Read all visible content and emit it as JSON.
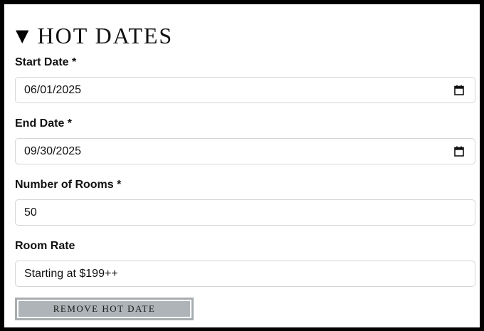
{
  "section": {
    "caret": "▼",
    "title": "HOT DATES"
  },
  "fields": {
    "start_date": {
      "label": "Start Date *",
      "value": "06/01/2025",
      "icon": "calendar-icon"
    },
    "end_date": {
      "label": "End Date *",
      "value": "09/30/2025",
      "icon": "calendar-icon"
    },
    "rooms": {
      "label": "Number of Rooms *",
      "value": "50"
    },
    "rate": {
      "label": "Room Rate",
      "value": "Starting at $199++"
    }
  },
  "actions": {
    "remove_label": "REMOVE HOT DATE"
  },
  "colors": {
    "frame": "#000000",
    "field_border": "#d6d6d6",
    "button_fill": "#aeb4b7",
    "button_border": "#a8adb0"
  }
}
